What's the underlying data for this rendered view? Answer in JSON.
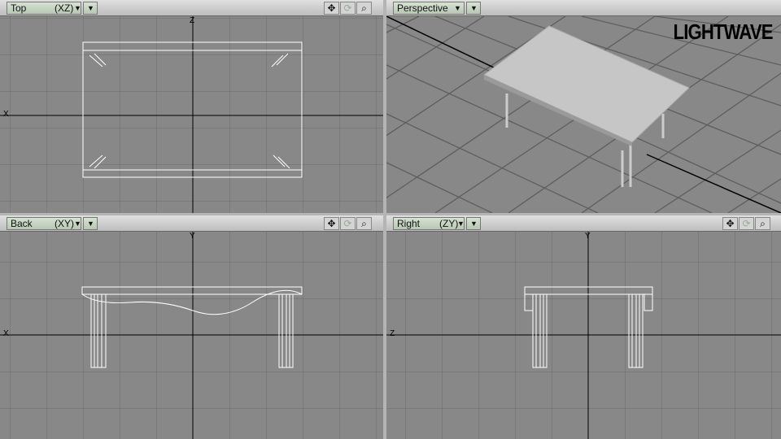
{
  "viewports": [
    {
      "name": "Top",
      "axes": "(XZ)"
    },
    {
      "name": "Perspective",
      "axes": ""
    },
    {
      "name": "Back",
      "axes": "(XY)"
    },
    {
      "name": "Right",
      "axes": "(ZY)"
    }
  ],
  "icons": {
    "move": "✥",
    "rotate": "⟳",
    "zoom": "🔍",
    "dropdown": "▼"
  },
  "logo": "LIGHTWAVE",
  "axis_labels": {
    "top": [
      "Z",
      "X"
    ],
    "back": [
      "Y",
      "X"
    ],
    "right": [
      "Y",
      "Z"
    ]
  }
}
